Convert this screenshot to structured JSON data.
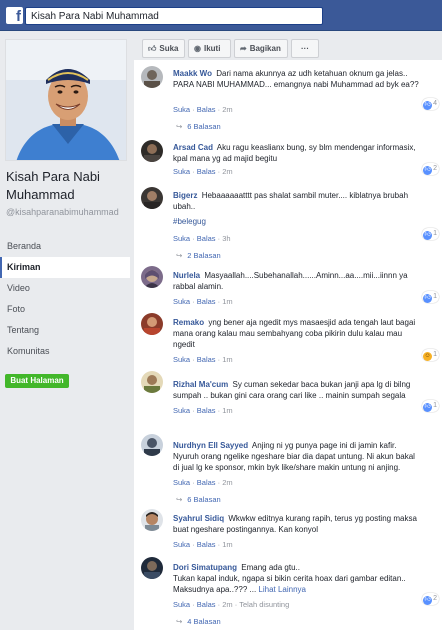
{
  "topbar": {
    "logo_letter": "f",
    "search_value": "Kisah Para Nabi Muhammad"
  },
  "page": {
    "name": "Kisah Para Nabi Muhammad",
    "handle": "@kisahparanabimuhammad",
    "nav": [
      "Beranda",
      "Kiriman",
      "Video",
      "Foto",
      "Tentang",
      "Komunitas"
    ],
    "active_nav": "Kiriman",
    "create_button": "Buat Halaman"
  },
  "actions": {
    "like": "Suka",
    "follow": "Ikuti",
    "share": "Bagikan",
    "more": "···"
  },
  "meta_labels": {
    "like": "Suka",
    "reply": "Balas",
    "sep": "·",
    "edited": "Telah disunting",
    "see_more": "Lihat Lainnya"
  },
  "comments": [
    {
      "author": "Maakk Wo",
      "text": "Dari nama akunnya az udh ketahuan oknum ga jelas.. PARA NABI MUHAMMAD... emangnya nabi Muhammad ad byk ea??",
      "time": "2m",
      "reactions": "4",
      "reaction_type": "like",
      "replies": "6 Balasan"
    },
    {
      "author": "Arsad Cad",
      "text": "Aku ragu keaslianx bung, sy blm mendengar informasix, kpal mana yg ad majid begitu",
      "time": "2m",
      "reactions": "2",
      "reaction_type": "like",
      "replies": ""
    },
    {
      "author": "Bigerz",
      "text": "Hebaaaaaatttt pas shalat sambil muter.... kiblatnya brubah ubah..",
      "hashtag": "#belegug",
      "time": "3h",
      "reactions": "1",
      "reaction_type": "like",
      "replies": "2 Balasan"
    },
    {
      "author": "Nurlela",
      "text": "Masyaallah....Subehanallah......Aminn...aa....mii...iinnn ya rabbal alamin.",
      "time": "1m",
      "reactions": "1",
      "reaction_type": "like",
      "replies": ""
    },
    {
      "author": "Remako",
      "text": "yng bener aja ngedit mys masaesjid ada tengah laut bagai mana orang kalau mau sembahyang coba pikirin dulu kalau mau ngedit",
      "time": "1m",
      "reactions": "1",
      "reaction_type": "haha",
      "replies": ""
    },
    {
      "author": "Rizhal Ma'cum",
      "text": "Sy cuman sekedar baca bukan janji apa lg di bilng sumpah .. bukan gini cara orang cari like .. mainin sumpah segala",
      "time": "1m",
      "reactions": "1",
      "reaction_type": "like",
      "replies": ""
    },
    {
      "author": "Nurdhyn Ell Sayyed",
      "text": "Anjing ni yg punya page ini di jamin kafir. Nyuruh orang ngelike ngeshare biar dia dapat untung. Ni akun bakal di jual lg ke sponsor, mkin byk like/share makin untung ni anjing.",
      "time": "2m",
      "reactions": "",
      "reaction_type": "",
      "replies": "6 Balasan"
    },
    {
      "author": "Syahrul Sidiq",
      "text": "Wkwkw editnya kurang rapih, terus yg posting maksa buat ngeshare postingannya. Kan konyol",
      "time": "1m",
      "reactions": "",
      "reaction_type": "",
      "replies": ""
    },
    {
      "author": "Dori Simatupang",
      "text": "Emang ada gtu..",
      "text2": "Tukan kapal induk, ngapa si bikin cerita hoax dari gambar editan.. Maksudnya apa..??? ...",
      "time": "2m",
      "reactions": "2",
      "reaction_type": "like",
      "replies": "4 Balasan"
    }
  ],
  "colors": {
    "brand": "#3b5998",
    "link": "#365899",
    "create_button": "#42b72a",
    "meta_text": "#90949c"
  }
}
